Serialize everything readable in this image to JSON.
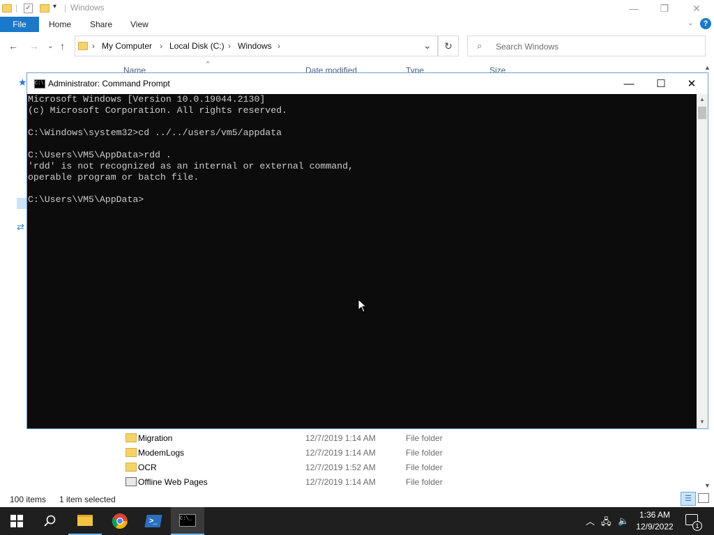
{
  "explorer": {
    "title": "Windows",
    "ribbon": {
      "file": "File",
      "home": "Home",
      "share": "Share",
      "view": "View"
    },
    "breadcrumbs": [
      "My Computer",
      "Local Disk (C:)",
      "Windows"
    ],
    "search_placeholder": "Search Windows",
    "columns": {
      "name": "Name",
      "date": "Date modified",
      "type": "Type",
      "size": "Size"
    },
    "rows": [
      {
        "name": "Migration",
        "date": "12/7/2019 1:14 AM",
        "type": "File folder"
      },
      {
        "name": "ModemLogs",
        "date": "12/7/2019 1:14 AM",
        "type": "File folder"
      },
      {
        "name": "OCR",
        "date": "12/7/2019 1:52 AM",
        "type": "File folder"
      },
      {
        "name": "Offline Web Pages",
        "date": "12/7/2019 1:14 AM",
        "type": "File folder"
      }
    ],
    "status": {
      "items": "100 items",
      "selected": "1 item selected"
    }
  },
  "cmd": {
    "title": "Administrator: Command Prompt",
    "lines": [
      "Microsoft Windows [Version 10.0.19044.2130]",
      "(c) Microsoft Corporation. All rights reserved.",
      "",
      "C:\\Windows\\system32>cd ../../users/vm5/appdata",
      "",
      "C:\\Users\\VM5\\AppData>rdd .",
      "'rdd' is not recognized as an internal or external command,",
      "operable program or batch file.",
      "",
      "C:\\Users\\VM5\\AppData>"
    ]
  },
  "taskbar": {
    "time": "1:36 AM",
    "date": "12/9/2022",
    "notification_count": "1"
  }
}
